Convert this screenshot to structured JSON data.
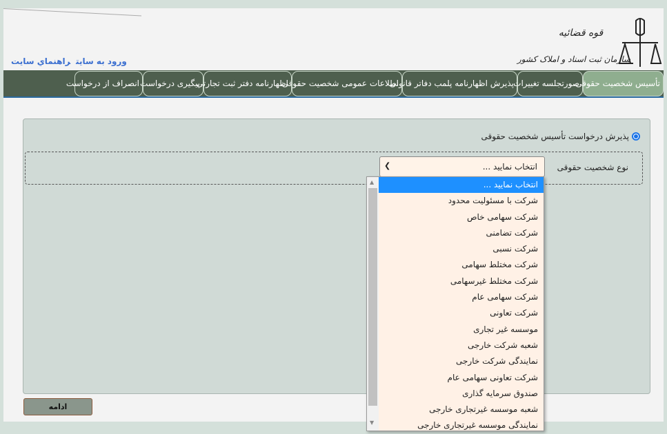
{
  "header": {
    "logo_text": [
      "قوه قضائیه",
      "سازمان ثبت اسناد و املاک کشور"
    ],
    "links": [
      "ورود به سایت",
      "راهنماي سايت"
    ]
  },
  "nav": {
    "tabs": [
      "تأسیس شخصیت حقوقی",
      "صورتجلسه تغییرات",
      "پذیرش اظهارنامه پلمب دفاتر قانونی",
      "اطلاعات عمومی شخصیت حقوقی",
      "اظهارنامه دفتر ثبت تجارتی",
      "پیگیری درخواست",
      "انصراف از درخواست"
    ],
    "active": 0
  },
  "form": {
    "radio_label": "پذیرش درخواست تأسیس شخصیت حقوقی",
    "type_label": "نوع شخصیت حقوقی",
    "select_value": "انتخاب نمایید ...",
    "options": [
      "انتخاب نمایید ...",
      "شرکت با مسئولیت محدود",
      "شرکت سهامی خاص",
      "شرکت تضامنی",
      "شرکت نسبی",
      "شرکت مختلط سهامی",
      "شرکت مختلط غیرسهامی",
      "شرکت سهامی عام",
      "شرکت تعاونی",
      "موسسه غیر تجاری",
      "شعبه شرکت خارجی",
      "نمایندگی شرکت خارجی",
      "شرکت تعاونی سهامی عام",
      "صندوق سرمایه گذاری",
      "شعبه موسسه غیرتجاری خارجی",
      "نمایندگی موسسه غیرتجاری خارجی"
    ]
  },
  "continue_label": "ادامه"
}
